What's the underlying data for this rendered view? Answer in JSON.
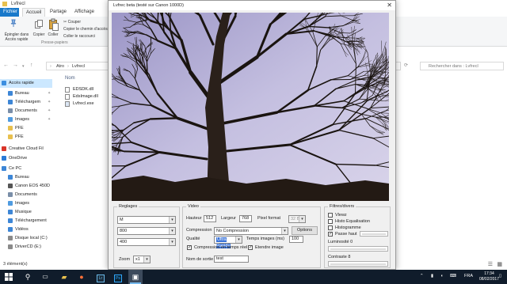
{
  "explorer": {
    "title": "Lvfrecl",
    "tabs": [
      "Fichier",
      "Accueil",
      "Partage",
      "Affichage"
    ],
    "ribbon": {
      "pin_label": "Épingler dans Accès rapide",
      "copy_label": "Copier",
      "paste_label": "Coller",
      "cut_label": "Couper",
      "copy_path_label": "Copier le chemin d'accès",
      "paste_shortcut_label": "Coller le raccourci",
      "clipboard_group": "Presse-papiers"
    },
    "breadcrumb": [
      "Atro",
      "Lvfrecl"
    ],
    "search_placeholder": "Rechercher dans : Lvfrecl",
    "nav_items": [
      {
        "label": "Accès rapide",
        "icon": "star-icon",
        "color": "#3b8ee0"
      },
      {
        "label": "Bureau",
        "icon": "desktop-icon",
        "color": "#3d86d6"
      },
      {
        "label": "Téléchargem",
        "icon": "download-icon",
        "color": "#3d86d6"
      },
      {
        "label": "Documents",
        "icon": "documents-icon",
        "color": "#7a8ea8"
      },
      {
        "label": "Images",
        "icon": "pictures-icon",
        "color": "#4f9be0"
      },
      {
        "label": "PFE",
        "icon": "folder-icon",
        "color": "#e8c04e"
      },
      {
        "label": "PFE",
        "icon": "folder-icon",
        "color": "#e8c04e"
      },
      {
        "label": "Creative Cloud Fil",
        "icon": "creative-cloud-icon",
        "color": "#d9352a"
      },
      {
        "label": "OneDrive",
        "icon": "onedrive-icon",
        "color": "#2a7ad6"
      },
      {
        "label": "Ce PC",
        "icon": "computer-icon",
        "color": "#3d86d6"
      },
      {
        "label": "Bureau",
        "icon": "desktop-icon",
        "color": "#3d86d6"
      },
      {
        "label": "Canon EOS 450D",
        "icon": "camera-icon",
        "color": "#555555"
      },
      {
        "label": "Documents",
        "icon": "documents-icon",
        "color": "#7a8ea8"
      },
      {
        "label": "Images",
        "icon": "pictures-icon",
        "color": "#4f9be0"
      },
      {
        "label": "Musique",
        "icon": "music-icon",
        "color": "#3d86d6"
      },
      {
        "label": "Téléchargement",
        "icon": "download-icon",
        "color": "#3d86d6"
      },
      {
        "label": "Vidéos",
        "icon": "videos-icon",
        "color": "#3d86d6"
      },
      {
        "label": "Disque local (C:)",
        "icon": "drive-icon",
        "color": "#8a8a8a"
      },
      {
        "label": "DriverCD (E:)",
        "icon": "drive-icon",
        "color": "#8a8a8a"
      }
    ],
    "column_name": "Nom",
    "files": [
      "EDSDK.dll",
      "EdsImage.dll",
      "Lvfrecl.exe"
    ],
    "status": "3 élément(s)"
  },
  "lvfrec": {
    "title": "Lvfrec beta (testé sur Canon 1000D)",
    "reglages": {
      "legend": "Reglages",
      "mode": "M",
      "value1": "800",
      "value2": "400",
      "zoom_label": "Zoom",
      "zoom": "x1"
    },
    "video": {
      "legend": "Video",
      "hauteur_label": "Hauteur",
      "hauteur": "512",
      "largeur_label": "Largeur",
      "largeur": "768",
      "pixel_format_label": "Pixel format",
      "pixel_format": "32 Bit",
      "compression_label": "Compression",
      "compression": "No Compression",
      "options_label": "Options",
      "qualite_label": "Qualité",
      "qualite": "Ultra Rapide",
      "temps_label": "Temps images (ms)",
      "temps": "100",
      "compression_rt_label": "Compression en temps réel",
      "compression_rt_checked": true,
      "etendre_label": "Etendre image",
      "etendre_checked": true,
      "nom_sortie_label": "Nom de sortie",
      "nom_sortie": "test"
    },
    "filtres": {
      "legend": "Filtres/divers",
      "vlewz_label": "Vlewz",
      "vlewz_checked": false,
      "histo_eq_label": "Histo Equalisation",
      "histo_eq_checked": false,
      "histogramme_label": "Histogramme",
      "histogramme_checked": false,
      "passe_haut_label": "Passe haut",
      "passe_haut_checked": true,
      "luminosite_label": "Luminosité 0",
      "contraste_label": "Contraste 8"
    }
  },
  "taskbar": {
    "lang": "FRA",
    "time": "17:34",
    "date": "08/02/2017"
  }
}
